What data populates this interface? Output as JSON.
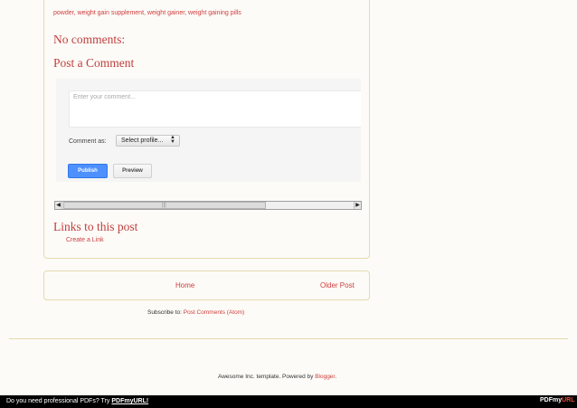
{
  "post": {
    "labels_text": "powder, weight gain supplement, weight gainer, weight gaining pills",
    "comments_heading": "No comments:",
    "post_comment_heading": "Post a Comment",
    "comment_form": {
      "placeholder": "Enter your comment...",
      "comment_as_label": "Comment as:",
      "profile_select_value": "Select profile...",
      "publish_label": "Publish",
      "preview_label": "Preview"
    },
    "scrollbar_grip": "|||",
    "links_heading": "Links to this post",
    "create_link_label": "Create a Link"
  },
  "pager": {
    "home_label": "Home",
    "older_label": "Older Post"
  },
  "subscribe": {
    "prefix": "Subscribe to: ",
    "link_label": "Post Comments (Atom)"
  },
  "footer": {
    "text": "Awesome Inc. template. Powered by ",
    "blogger_link": "Blogger",
    "suffix": "."
  },
  "pdf_banner": {
    "text": "Do you need professional PDFs? Try ",
    "link_label": "PDFmyURL!",
    "logo_prefix": "PDFmy",
    "logo_suffix": "URL"
  },
  "colors": {
    "accent_link": "#cf3e3e",
    "card_border": "#e3dbb0",
    "publish_blue": "#4d90fe"
  }
}
